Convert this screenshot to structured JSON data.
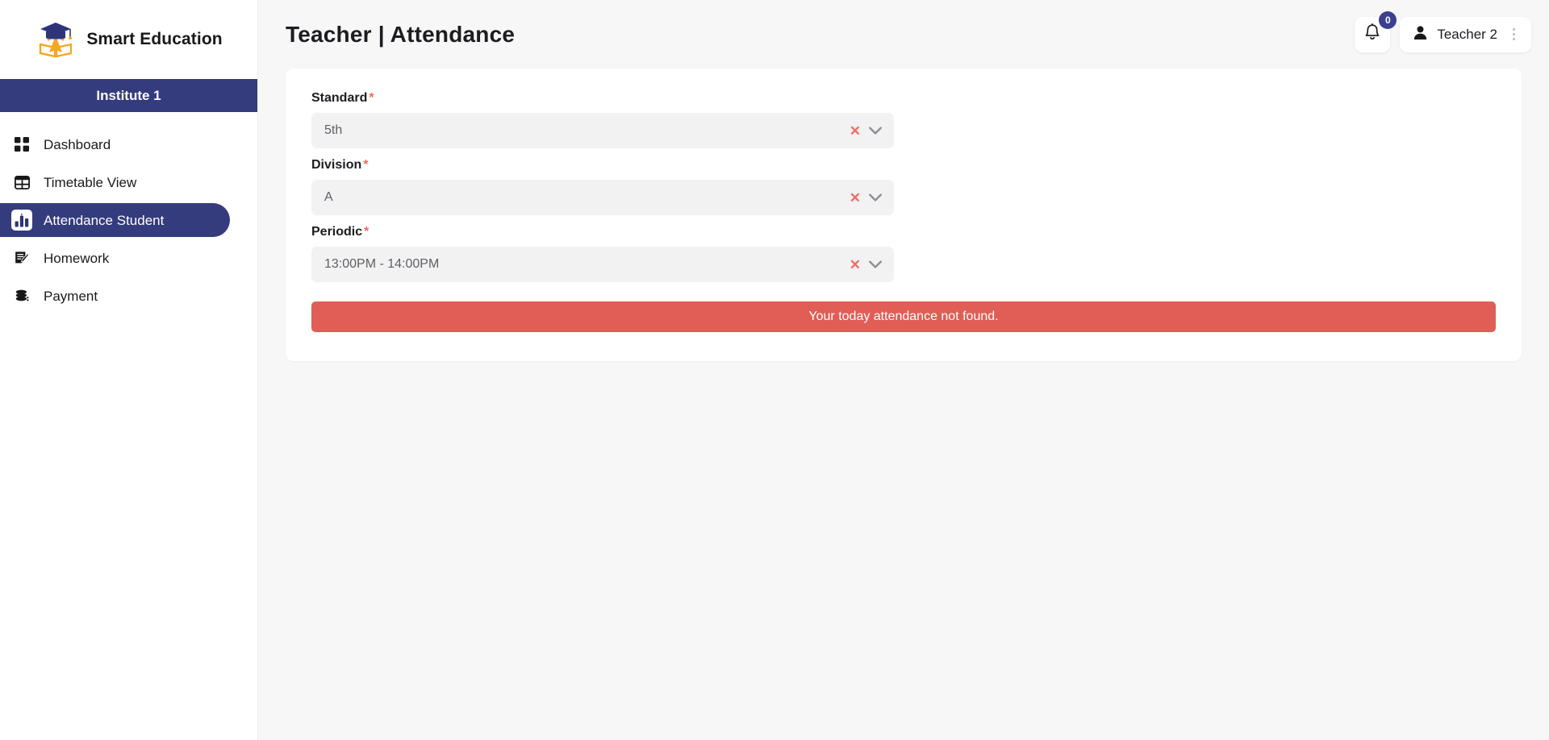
{
  "brand": {
    "title": "Smart Education",
    "logo_icon": "graduation-cap-book-logo"
  },
  "sidebar": {
    "institute": "Institute 1",
    "items": [
      {
        "label": "Dashboard",
        "icon": "grid-icon",
        "active": false
      },
      {
        "label": "Timetable View",
        "icon": "table-icon",
        "active": false
      },
      {
        "label": "Attendance Student",
        "icon": "bar-chart-icon",
        "active": true
      },
      {
        "label": "Homework",
        "icon": "note-edit-icon",
        "active": false
      },
      {
        "label": "Payment",
        "icon": "coins-icon",
        "active": false
      }
    ]
  },
  "header": {
    "title": "Teacher | Attendance",
    "notification_icon": "bell-icon",
    "notification_count": "0",
    "user_icon": "person-icon",
    "user_name": "Teacher 2",
    "menu_icon": "kebab-menu-icon"
  },
  "form": {
    "fields": [
      {
        "label": "Standard",
        "required": "*",
        "value": "5th",
        "clear_icon": "close-x-icon",
        "chevron_icon": "chevron-down-icon"
      },
      {
        "label": "Division",
        "required": "*",
        "value": "A",
        "clear_icon": "close-x-icon",
        "chevron_icon": "chevron-down-icon"
      },
      {
        "label": "Periodic",
        "required": "*",
        "value": "13:00PM - 14:00PM",
        "clear_icon": "close-x-icon",
        "chevron_icon": "chevron-down-icon"
      }
    ]
  },
  "alert": {
    "message": "Your today attendance not found.",
    "color": "#e05e55"
  },
  "theme": {
    "navy": "#343c7d",
    "danger": "#e05e55",
    "page_bg": "#f7f7f8",
    "input_bg": "#f2f2f2"
  }
}
